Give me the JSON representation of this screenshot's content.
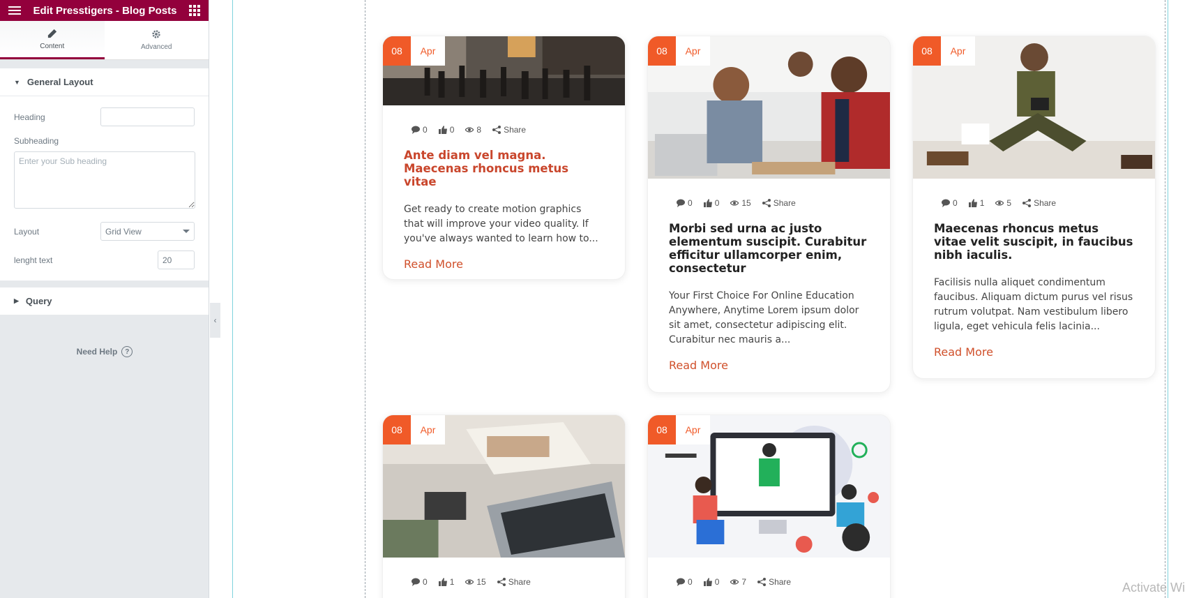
{
  "panel": {
    "title": "Edit Presstigers - Blog Posts",
    "tabs": [
      {
        "label": "Content",
        "icon": "pencil-icon"
      },
      {
        "label": "Advanced",
        "icon": "gear-icon"
      }
    ],
    "general_layout": {
      "title": "General Layout",
      "heading_label": "Heading",
      "heading_value": "",
      "subheading_label": "Subheading",
      "subheading_placeholder": "Enter your Sub heading",
      "layout_label": "Layout",
      "layout_value": "Grid View",
      "length_label": "lenght text",
      "length_value": "20"
    },
    "query_title": "Query",
    "need_help": "Need Help",
    "help_glyph": "?"
  },
  "posts": [
    {
      "day": "08",
      "month": "Apr",
      "comments": "0",
      "likes": "0",
      "views": "8",
      "share": "Share",
      "title": "Ante diam vel magna. Maecenas rhoncus metus vitae",
      "excerpt": "Get ready to create motion graphics that will improve your video quality. If you've always wanted to learn how to...",
      "read_more": "Read More"
    },
    {
      "day": "08",
      "month": "Apr",
      "comments": "0",
      "likes": "0",
      "views": "15",
      "share": "Share",
      "title": "Morbi sed urna ac justo elementum suscipit. Curabitur efficitur ullamcorper enim, consectetur",
      "excerpt": "Your First Choice For Online Education Anywhere, Anytime Lorem ipsum dolor sit amet, consectetur adipiscing elit. Curabitur nec mauris a...",
      "read_more": "Read More"
    },
    {
      "day": "08",
      "month": "Apr",
      "comments": "0",
      "likes": "1",
      "views": "5",
      "share": "Share",
      "title": "Maecenas rhoncus metus vitae velit suscipit, in faucibus nibh iaculis.",
      "excerpt": "Facilisis nulla aliquet condimentum faucibus. Aliquam dictum purus vel risus rutrum volutpat. Nam vestibulum libero ligula, eget vehicula felis lacinia...",
      "read_more": "Read More"
    },
    {
      "day": "08",
      "month": "Apr",
      "comments": "0",
      "likes": "1",
      "views": "15",
      "share": "Share"
    },
    {
      "day": "08",
      "month": "Apr",
      "comments": "0",
      "likes": "0",
      "views": "7",
      "share": "Share"
    }
  ],
  "watermark": "Activate Wi",
  "colors": {
    "brand": "#93003c",
    "accent": "#f05a28",
    "link": "#d0502b"
  }
}
